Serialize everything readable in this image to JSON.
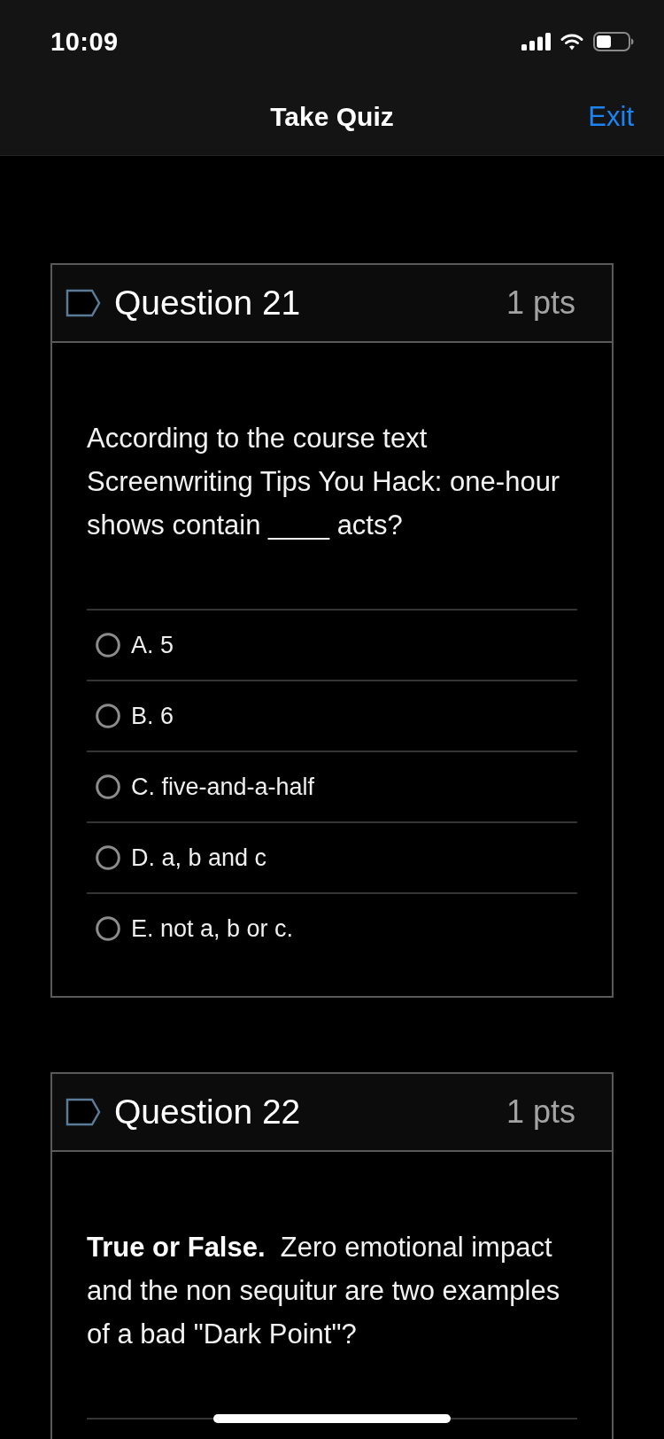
{
  "status_bar": {
    "time": "10:09"
  },
  "nav_bar": {
    "title": "Take Quiz",
    "exit": "Exit"
  },
  "questions": [
    {
      "title": "Question 21",
      "points": "1 pts",
      "flagged": false,
      "text": "According to the course text Screenwriting Tips You Hack: one-hour shows contain ____ acts?",
      "options": [
        {
          "label": "A. 5",
          "selected": false
        },
        {
          "label": "B. 6",
          "selected": false
        },
        {
          "label": "C. five-and-a-half",
          "selected": false
        },
        {
          "label": "D. a, b and c",
          "selected": false
        },
        {
          "label": "E. not a, b or c.",
          "selected": false
        }
      ]
    },
    {
      "title": "Question 22",
      "points": "1 pts",
      "flagged": false,
      "text": "**True or False.**  Zero emotional impact and the non sequitur are two examples of a bad \"Dark Point\"?"
    }
  ]
}
